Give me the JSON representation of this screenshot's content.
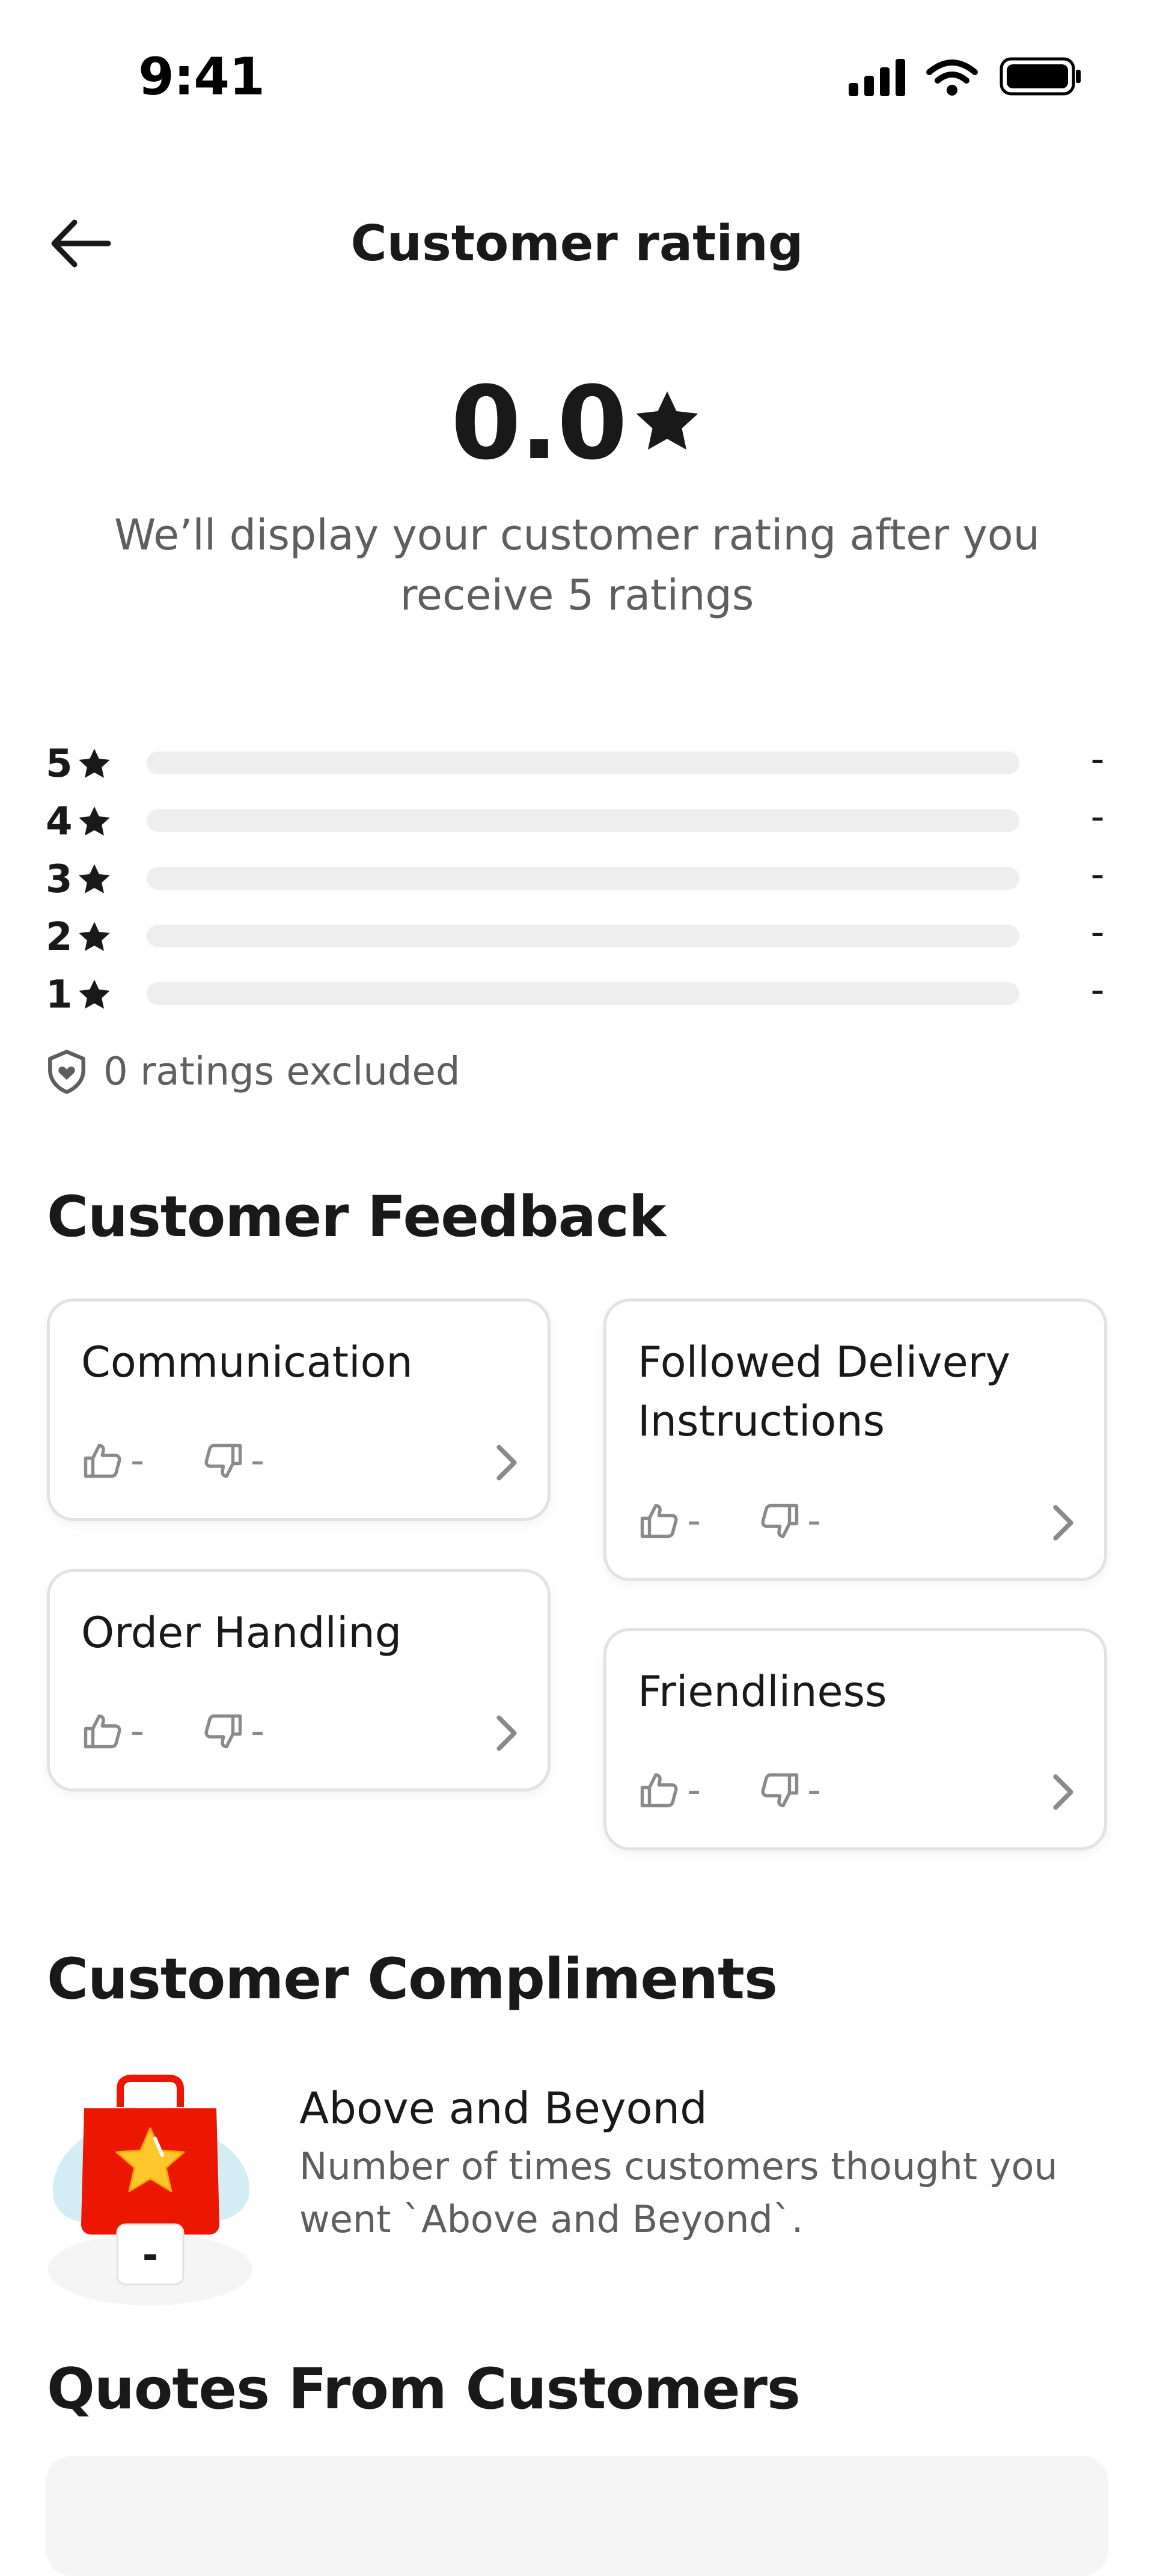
{
  "status_bar": {
    "time": "9:41"
  },
  "header": {
    "title": "Customer rating"
  },
  "summary": {
    "rating": "0.0",
    "note": "We’ll display your customer rating after you receive 5 ratings"
  },
  "distribution": [
    {
      "stars": "5",
      "count": "-",
      "fraction": 0
    },
    {
      "stars": "4",
      "count": "-",
      "fraction": 0
    },
    {
      "stars": "3",
      "count": "-",
      "fraction": 0
    },
    {
      "stars": "2",
      "count": "-",
      "fraction": 0
    },
    {
      "stars": "1",
      "count": "-",
      "fraction": 0
    }
  ],
  "excluded_text": "0 ratings excluded",
  "feedback": {
    "title": "Customer Feedback",
    "cards": [
      {
        "title": "Communication",
        "up": "-",
        "down": "-"
      },
      {
        "title": "Followed Delivery Instructions",
        "up": "-",
        "down": "-"
      },
      {
        "title": "Order Handling",
        "up": "-",
        "down": "-"
      },
      {
        "title": "Friendliness",
        "up": "-",
        "down": "-"
      }
    ]
  },
  "compliments": {
    "title": "Customer Compliments",
    "items": [
      {
        "title": "Above and Beyond",
        "description": "Number of times customers thought you went `Above and Beyond`.",
        "count": "-"
      }
    ]
  },
  "quotes": {
    "title": "Quotes From Customers"
  },
  "colors": {
    "text": "#191919",
    "muted": "#5e5e5e",
    "track": "#eeeeee",
    "bag": "#eb1700",
    "star": "#ffc72c"
  }
}
